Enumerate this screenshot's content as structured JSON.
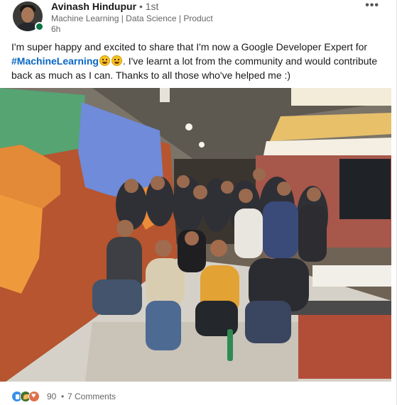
{
  "author": {
    "name": "Avinash Hindupur",
    "degree": "• 1st",
    "headline": "Machine Learning | Data Science | Product",
    "time": "6h"
  },
  "menu": {
    "icon": "more-horizontal-icon",
    "label": "•••"
  },
  "post": {
    "text_before": "I'm super happy and excited to share that I'm now a Google Developer Expert for",
    "hashtag": "#MachineLearning",
    "text_after": ". I've learnt a lot from the community and would contribute back as much as I can. Thanks to all those who've helped me :)"
  },
  "photo": {
    "description_icon": "group-photo-image"
  },
  "social": {
    "reactions": [
      "like-icon",
      "celebrate-icon",
      "love-icon"
    ],
    "count": "90",
    "separator": "•",
    "comments": "7 Comments"
  },
  "colors": {
    "link": "#0a66c2",
    "presence": "#057642",
    "text": "#000000e6",
    "muted": "#666666"
  }
}
